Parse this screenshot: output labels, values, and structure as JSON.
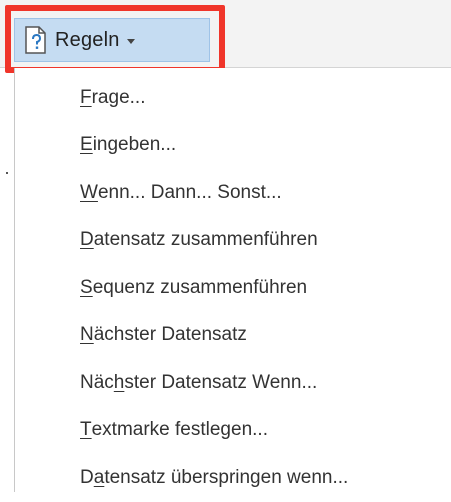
{
  "button": {
    "label": "Regeln",
    "icon": "document-question-icon",
    "caret_icon": "caret-down-icon"
  },
  "menu": {
    "items": [
      {
        "pre": "",
        "mnemonic": "F",
        "post": "rage..."
      },
      {
        "pre": "",
        "mnemonic": "E",
        "post": "ingeben..."
      },
      {
        "pre": "",
        "mnemonic": "W",
        "post": "enn... Dann... Sonst..."
      },
      {
        "pre": "",
        "mnemonic": "D",
        "post": "atensatz zusammenführen"
      },
      {
        "pre": "",
        "mnemonic": "S",
        "post": "equenz zusammenführen"
      },
      {
        "pre": "",
        "mnemonic": "N",
        "post": "ächster Datensatz"
      },
      {
        "pre": "Näc",
        "mnemonic": "h",
        "post": "ster Datensatz Wenn..."
      },
      {
        "pre": "",
        "mnemonic": "T",
        "post": "extmarke festlegen..."
      },
      {
        "pre": "D",
        "mnemonic": "a",
        "post": "tensatz überspringen wenn..."
      }
    ]
  },
  "colors": {
    "highlight_frame": "#f0352a",
    "button_pressed_bg": "#c5dcf2"
  }
}
